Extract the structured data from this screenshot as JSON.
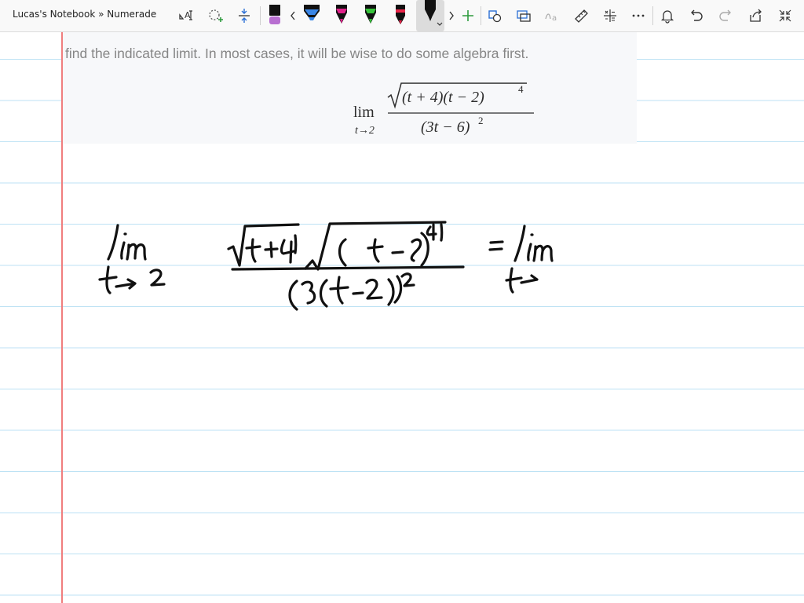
{
  "window": {
    "title": "Lucas's Notebook » Numerade"
  },
  "toolbar": {
    "tools": [
      "lasso-select-text-icon",
      "lasso-add-icon",
      "insert-space-icon",
      "pen-black-icon",
      "chevron-left-icon",
      "pen-blue-icon",
      "pen-magenta-icon",
      "pen-green-icon",
      "pen-red-icon",
      "pen-black-selected-icon",
      "chevron-right-icon",
      "add-pen-icon",
      "shapes-icon",
      "lasso-icon",
      "ink-to-text-icon",
      "ruler-icon",
      "math-icon",
      "more-icon",
      "notification-icon",
      "undo-icon",
      "redo-icon",
      "share-icon",
      "collapse-icon"
    ],
    "colors": {
      "black": "#111111",
      "blue": "#3a86e6",
      "magenta": "#e0218a",
      "green": "#36c23a",
      "red": "#e8264a",
      "purple_tip": "#b86fd1",
      "add": "#2e9b3e"
    }
  },
  "problem": {
    "text": "find the indicated limit. In most cases, it will be wise to do some algebra first.",
    "formula": {
      "lim": "lim",
      "sub": "t→2",
      "numerator": "(t + 4)(t − 2)",
      "numerator_exp": "4",
      "denominator": "(3t − 6)",
      "denominator_exp": "2"
    }
  },
  "page": {
    "line_color": "#bde2f4",
    "margin_color": "#f07e7e"
  }
}
